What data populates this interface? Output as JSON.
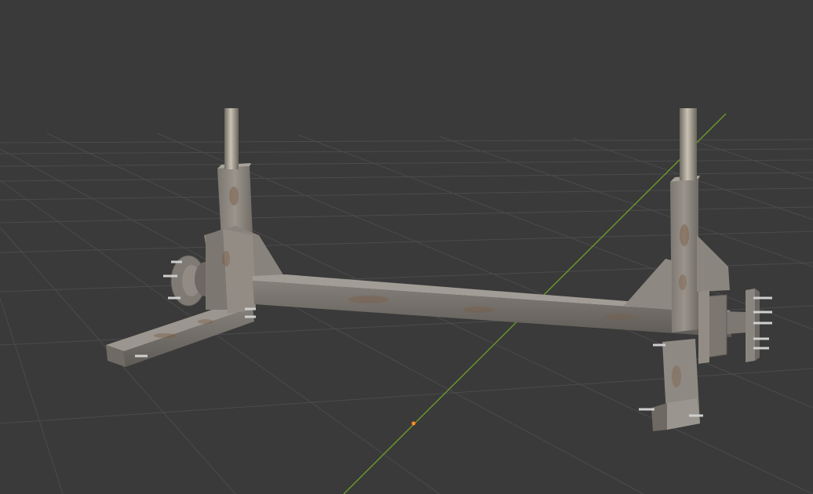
{
  "viewport": {
    "background": "#3a3a3a",
    "grid_color": "#4a4a4a",
    "y_axis_color": "#6f9a2e",
    "origin_color": "#ff8a1f"
  },
  "model": {
    "metal_color": "#8a8580",
    "rust_color": "#7a5a40",
    "post_color": "#a09a8e",
    "bolt_color": "#c8c8c8"
  }
}
